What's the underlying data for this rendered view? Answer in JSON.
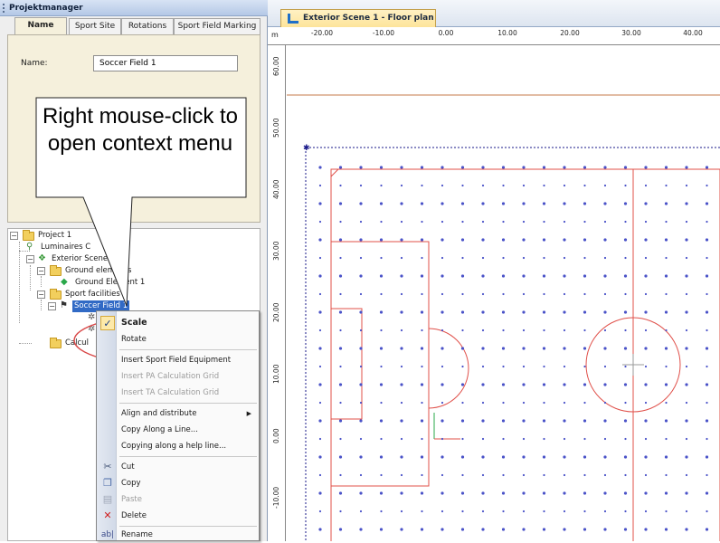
{
  "left_panel": {
    "title": "Projektmanager",
    "tabs": [
      "Name",
      "Sport Site",
      "Rotations",
      "Sport Field Marking"
    ],
    "active_tab": "Name",
    "name_label": "Name:",
    "name_value": "Soccer Field 1"
  },
  "tree": {
    "items": [
      {
        "label": "Project 1"
      },
      {
        "label": "Luminaires C"
      },
      {
        "label": "Exterior Scene"
      },
      {
        "label": "Ground elements"
      },
      {
        "label": "Ground Element 1"
      },
      {
        "label": "Sport facilities"
      },
      {
        "label": "Soccer Field 1"
      },
      {
        "label": "Calcul"
      }
    ]
  },
  "callout": {
    "text": "Right mouse-click to open context menu"
  },
  "context_menu": {
    "items": [
      {
        "label": "Scale",
        "icon": "checkmark-icon"
      },
      {
        "label": "Rotate"
      },
      {
        "label": "Insert Sport Field Equipment"
      },
      {
        "label": "Insert PA Calculation Grid"
      },
      {
        "label": "Insert TA Calculation Grid"
      },
      {
        "label": "Align and distribute"
      },
      {
        "label": "Copy Along a Line..."
      },
      {
        "label": "Copying along a help line..."
      },
      {
        "label": "Cut",
        "icon": "scissors-icon"
      },
      {
        "label": "Copy",
        "icon": "copy-icon"
      },
      {
        "label": "Paste",
        "icon": "paste-icon"
      },
      {
        "label": "Delete",
        "icon": "delete-icon"
      },
      {
        "label": "Rename",
        "icon": "rename-icon"
      }
    ],
    "highlight_color": "#d94a4a"
  },
  "document": {
    "tab_title": "Exterior Scene 1 - Floor plan",
    "units": "m",
    "x_ticks": [
      "-20.00",
      "-10.00",
      "0.00",
      "10.00",
      "20.00",
      "30.00",
      "40.00"
    ],
    "y_ticks": [
      "60.00",
      "50.00",
      "40.00",
      "30.00",
      "20.00",
      "10.00",
      "0.00",
      "-10.00"
    ],
    "field_line_color": "#e0504a",
    "grid_point_color": "#4a52c8"
  }
}
